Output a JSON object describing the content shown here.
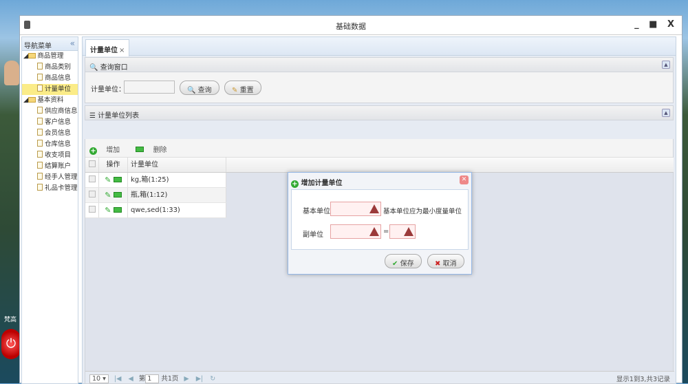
{
  "desktop": {
    "user_name": "梵高"
  },
  "window": {
    "title": "基础数据",
    "controls": "_ ■ X"
  },
  "sidebar": {
    "title": "导航菜单",
    "collapse": "«",
    "groups": [
      {
        "label": "商品管理",
        "items": [
          "商品类别",
          "商品信息",
          "计量单位"
        ]
      },
      {
        "label": "基本资料",
        "items": [
          "供应商信息",
          "客户信息",
          "会员信息",
          "仓库信息",
          "收支项目",
          "结算账户",
          "经手人管理",
          "礼品卡管理"
        ]
      }
    ]
  },
  "tab": {
    "label": "计量单位",
    "close": "×"
  },
  "query": {
    "title": "查询窗口",
    "field_label": "计量单位：",
    "field_value": "",
    "search_btn": "查询",
    "reset_btn": "重置"
  },
  "list": {
    "title": "计量单位列表",
    "add_btn": "增加",
    "delete_btn": "删除",
    "columns": [
      "操作",
      "计量单位"
    ],
    "rows": [
      "kg,箱(1:25)",
      "瓶,箱(1:12)",
      "qwe,sed(1:33)"
    ]
  },
  "pager": {
    "page_size": "10 ▾",
    "page_prefix": "第",
    "page": "1",
    "page_suffix": "共1页",
    "info": "显示1到3,共3记录"
  },
  "dialog": {
    "title": "增加计量单位",
    "base_label": "基本单位",
    "base_hint": "基本单位应为最小度量单位",
    "sub_label": "副单位",
    "equals": "=",
    "save_btn": "保存",
    "cancel_btn": "取消"
  }
}
